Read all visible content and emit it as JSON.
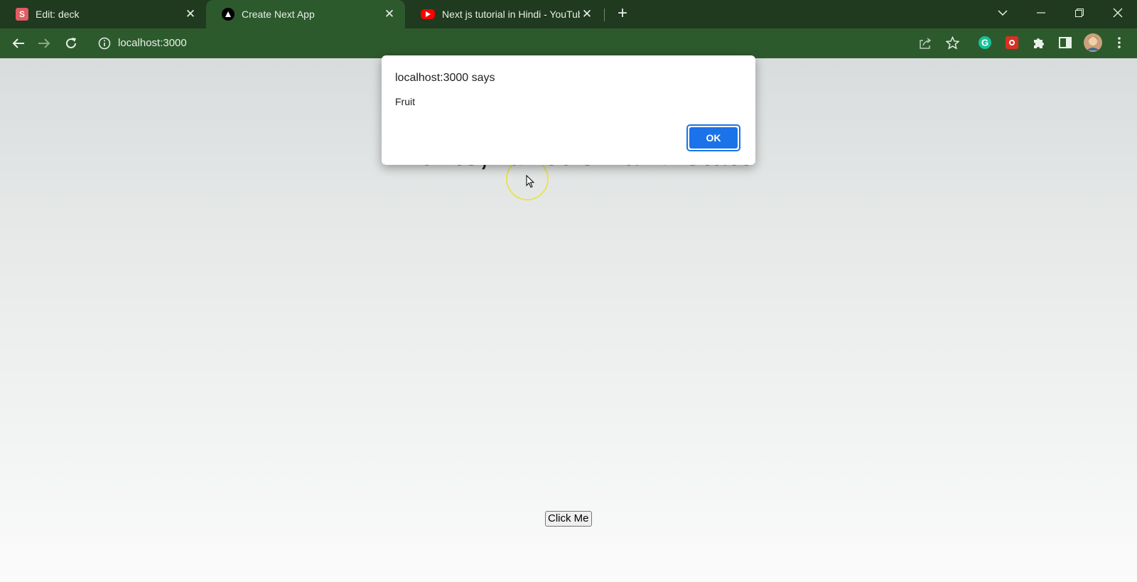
{
  "browser": {
    "tabs": [
      {
        "title": "Edit: deck",
        "favicon": "s-app-icon",
        "active": false
      },
      {
        "title": "Create Next App",
        "favicon": "nextjs-triangle-icon",
        "active": true
      },
      {
        "title": "Next js tutorial in Hindi - YouTub",
        "favicon": "youtube-icon",
        "active": false
      }
    ],
    "address": "localhost:3000",
    "extensions": [
      "grammarly-icon",
      "extension-red-icon",
      "puzzle-icon",
      "sidepanel-icon",
      "profile-avatar"
    ]
  },
  "dialog": {
    "title": "localhost:3000 says",
    "message": "Fruit",
    "ok_label": "OK"
  },
  "page": {
    "heading": "Events, function and state",
    "button_label": "Click Me"
  },
  "colors": {
    "tabstrip": "#1f3a1f",
    "toolbar": "#2d5a2d",
    "dialog_button": "#1a73e8"
  }
}
